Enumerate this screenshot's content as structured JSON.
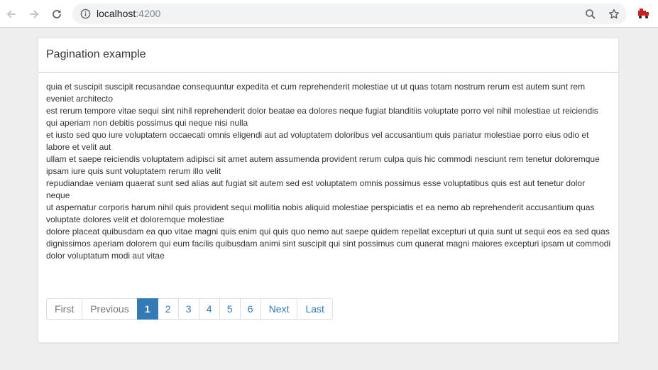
{
  "browser": {
    "url_host": "localhost",
    "url_port": ":4200",
    "icons": [
      "back-arrow-icon",
      "forward-arrow-icon",
      "reload-icon",
      "info-icon",
      "zoom-icon",
      "star-icon",
      "extension-icon"
    ]
  },
  "panel": {
    "title": "Pagination example",
    "items": [
      "quia et suscipit suscipit recusandae consequuntur expedita et cum reprehenderit molestiae ut ut quas totam nostrum rerum est autem sunt rem eveniet architecto",
      "est rerum tempore vitae sequi sint nihil reprehenderit dolor beatae ea dolores neque fugiat blanditiis voluptate porro vel nihil molestiae ut reiciendis qui aperiam non debitis possimus qui neque nisi nulla",
      "et iusto sed quo iure voluptatem occaecati omnis eligendi aut ad voluptatem doloribus vel accusantium quis pariatur molestiae porro eius odio et labore et velit aut",
      "ullam et saepe reiciendis voluptatem adipisci sit amet autem assumenda provident rerum culpa quis hic commodi nesciunt rem tenetur doloremque ipsam iure quis sunt voluptatem rerum illo velit",
      "repudiandae veniam quaerat sunt sed alias aut fugiat sit autem sed est voluptatem omnis possimus esse voluptatibus quis est aut tenetur dolor neque",
      "ut aspernatur corporis harum nihil quis provident sequi mollitia nobis aliquid molestiae perspiciatis et ea nemo ab reprehenderit accusantium quas voluptate dolores velit et doloremque molestiae",
      "dolore placeat quibusdam ea quo vitae magni quis enim qui quis quo nemo aut saepe quidem repellat excepturi ut quia sunt ut sequi eos ea sed quas",
      "dignissimos aperiam dolorem qui eum facilis quibusdam animi sint suscipit qui sint possimus cum quaerat magni maiores excepturi ipsam ut commodi dolor voluptatum modi aut vitae"
    ]
  },
  "pagination": {
    "first": "First",
    "previous": "Previous",
    "pages": [
      "1",
      "2",
      "3",
      "4",
      "5",
      "6"
    ],
    "active_page": "1",
    "next": "Next",
    "last": "Last"
  },
  "colors": {
    "accent": "#337ab7",
    "disabled_text": "#777777",
    "text": "#333333",
    "page_bg": "#eeeeee"
  }
}
